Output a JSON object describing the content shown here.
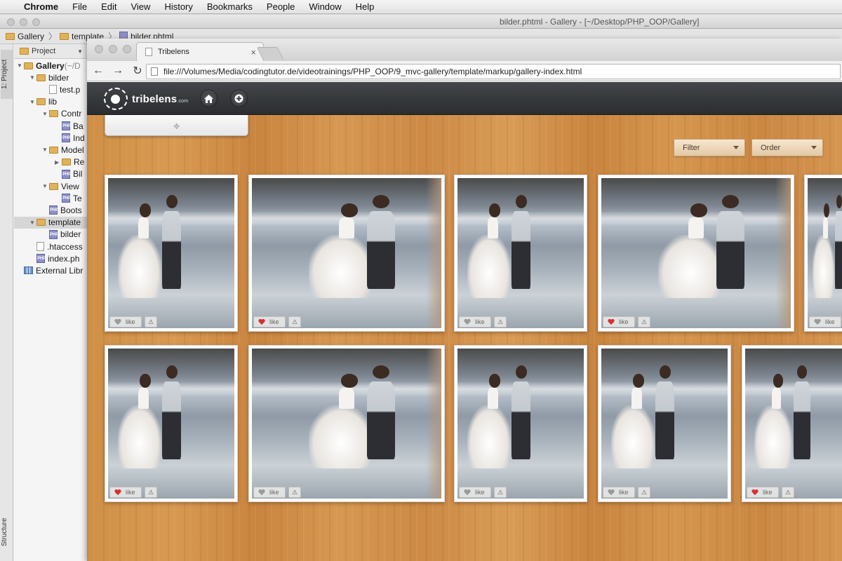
{
  "menubar": {
    "apple": "",
    "items": [
      "Chrome",
      "File",
      "Edit",
      "View",
      "History",
      "Bookmarks",
      "People",
      "Window",
      "Help"
    ]
  },
  "ide": {
    "window_title": "bilder.phtml - Gallery - [~/Desktop/PHP_OOP/Gallery]",
    "breadcrumbs": [
      "Gallery",
      "template",
      "bilder.phtml"
    ],
    "side_tabs": {
      "project": "1: Project",
      "structure": "Structure"
    },
    "project_dropdown": "Project",
    "tree": [
      {
        "label": "Gallery",
        "suffix": " (~/D",
        "icon": "folder",
        "depth": 0,
        "open": true,
        "bold": true
      },
      {
        "label": "bilder",
        "icon": "folder",
        "depth": 1,
        "open": true
      },
      {
        "label": "test.p",
        "icon": "file",
        "depth": 2
      },
      {
        "label": "lib",
        "icon": "folder",
        "depth": 1,
        "open": true
      },
      {
        "label": "Contr",
        "icon": "folder",
        "depth": 2,
        "open": true
      },
      {
        "label": "Ba",
        "icon": "php",
        "depth": 3
      },
      {
        "label": "Ind",
        "icon": "php",
        "depth": 3
      },
      {
        "label": "Model",
        "icon": "folder",
        "depth": 2,
        "open": true
      },
      {
        "label": "Re",
        "icon": "folder",
        "depth": 3,
        "closed": true
      },
      {
        "label": "Bil",
        "icon": "php",
        "depth": 3
      },
      {
        "label": "View",
        "icon": "folder",
        "depth": 2,
        "open": true
      },
      {
        "label": "Te",
        "icon": "php",
        "depth": 3
      },
      {
        "label": "Boots",
        "icon": "php",
        "depth": 2
      },
      {
        "label": "template",
        "icon": "folder",
        "depth": 1,
        "open": true,
        "selected": true
      },
      {
        "label": "bilder",
        "icon": "php",
        "depth": 2
      },
      {
        "label": ".htaccess",
        "icon": "file",
        "depth": 1
      },
      {
        "label": "index.ph",
        "icon": "php",
        "depth": 1
      },
      {
        "label": "External Libr",
        "icon": "lib",
        "depth": 0
      }
    ]
  },
  "browser": {
    "tab_title": "Tribelens",
    "tab_close": "×",
    "url": "file:///Volumes/Media/codingtutor.de/videotrainings/PHP_OOP/9_mvc-gallery/template/markup/gallery-index.html",
    "nav": {
      "back": "←",
      "forward": "→",
      "reload": "↻"
    }
  },
  "site": {
    "logo_text": "tribelens",
    "logo_suffix": ".com",
    "home_icon": "home-icon",
    "add_icon": "plus-icon",
    "filter_label": "Filter",
    "order_label": "Order",
    "like_label": "like",
    "flag_glyph": "⚠",
    "colors": {
      "liked": "#d9302f",
      "unliked": "#9a9a9a",
      "topbar": "#2f3134"
    }
  },
  "gallery": {
    "rows": [
      [
        {
          "liked": false
        },
        {
          "liked": true
        },
        {
          "liked": false
        },
        {
          "liked": true
        },
        {
          "liked": false
        }
      ],
      [
        {
          "liked": true
        },
        {
          "liked": false
        },
        {
          "liked": false
        },
        {
          "liked": false
        },
        {
          "liked": true
        }
      ]
    ]
  }
}
